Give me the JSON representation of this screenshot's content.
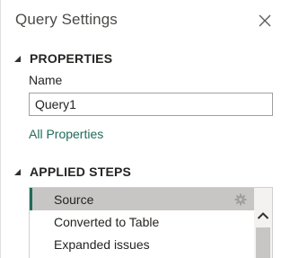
{
  "pane": {
    "title": "Query Settings"
  },
  "properties": {
    "header": "PROPERTIES",
    "name_label": "Name",
    "name_value": "Query1",
    "all_properties_link": "All Properties"
  },
  "applied_steps": {
    "header": "APPLIED STEPS",
    "steps": [
      {
        "label": "Source",
        "selected": true,
        "icon": "gear-icon"
      },
      {
        "label": "Converted to Table",
        "selected": false
      },
      {
        "label": "Expanded issues",
        "selected": false
      }
    ]
  },
  "colors": {
    "accent": "#1f6b5a",
    "selected_row": "#c8c6c4",
    "text": "#252423"
  },
  "icons": {
    "close": "close-icon",
    "collapse": "caret-down-icon",
    "scroll_up": "chevron-up-icon"
  }
}
